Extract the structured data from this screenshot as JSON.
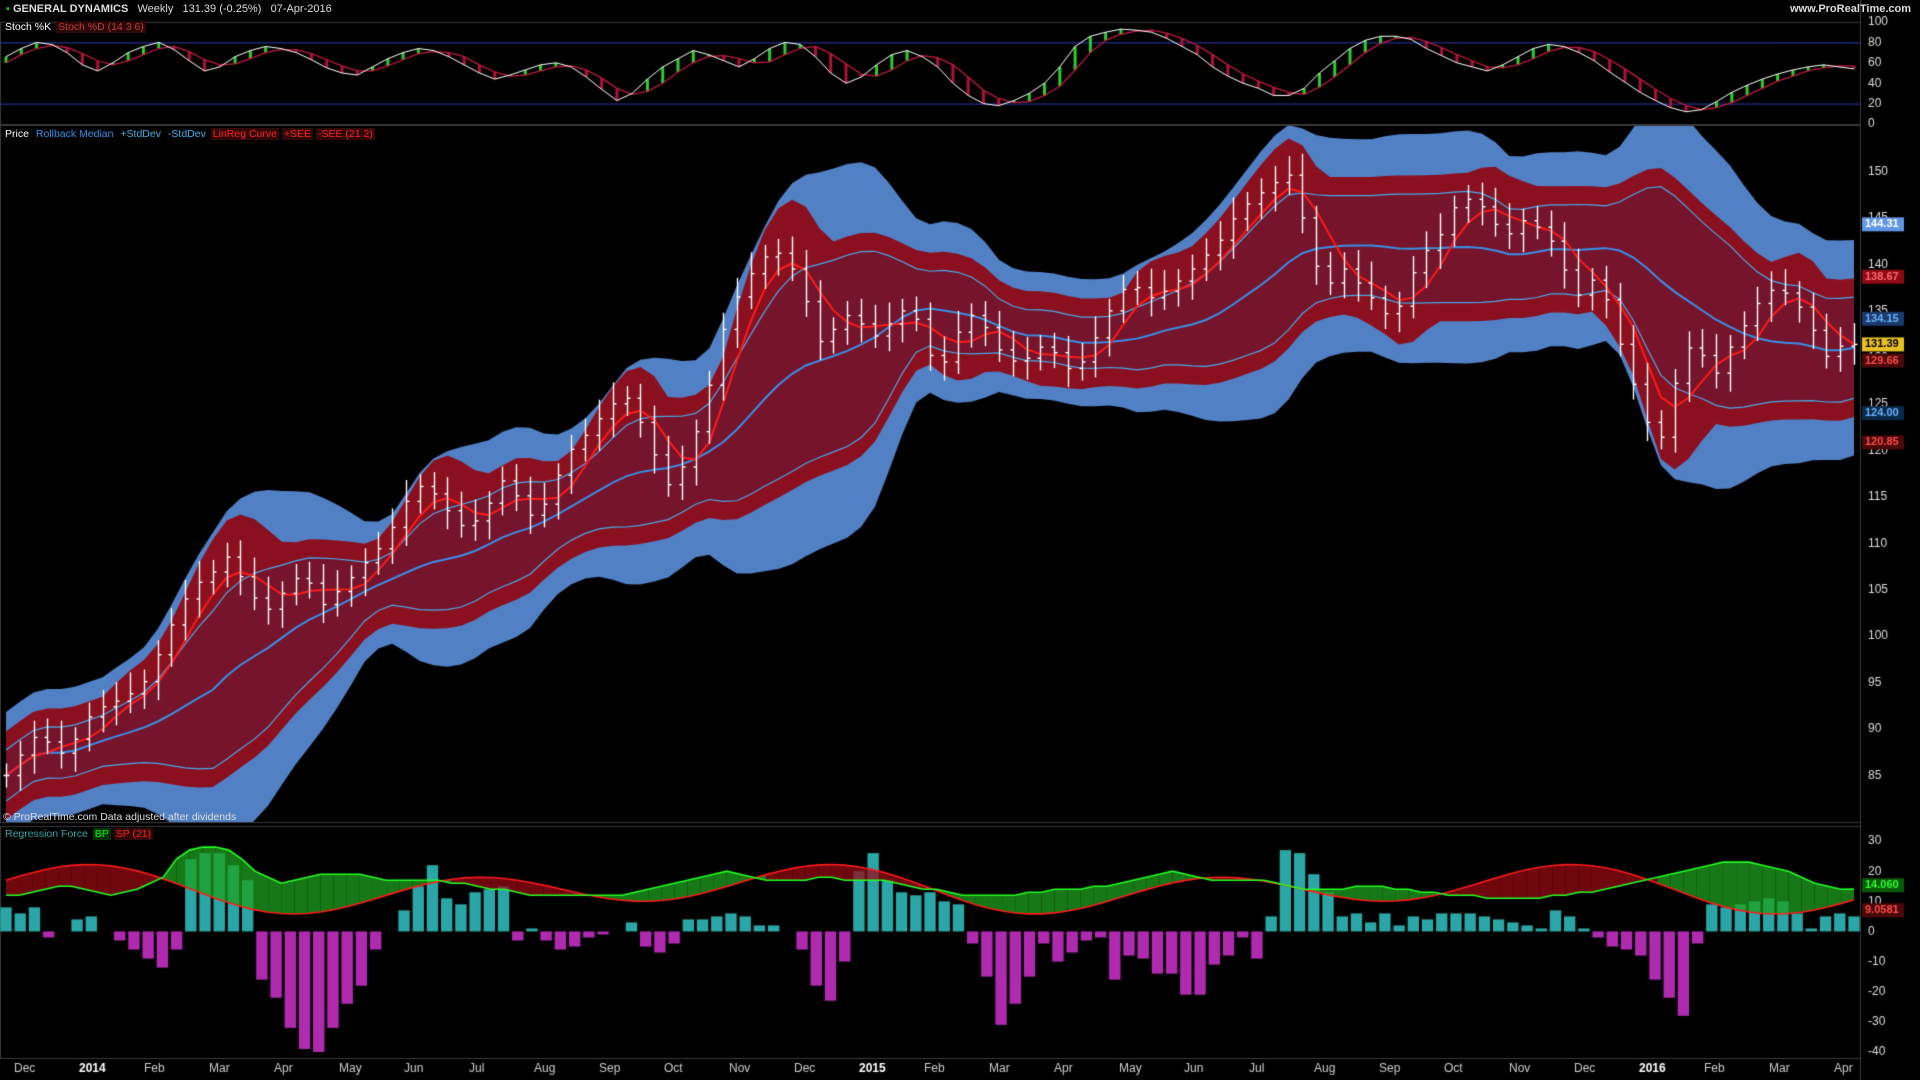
{
  "header": {
    "symbol": "GENERAL DYNAMICS",
    "period": "Weekly",
    "quote": "131.39 (-0.25%)",
    "date": "07-Apr-2016",
    "site": "www.ProRealTime.com"
  },
  "colors": {
    "bull_green": "#2ecc2e",
    "bear_red": "#b0103a",
    "band_red": "#8e0a16",
    "median_blue": "#3a8ee8",
    "cloud_blue": "#5f97e6",
    "linreg_red": "#ff1a1a",
    "hist_teal": "#2aa6a6",
    "hist_magenta": "#b02ab0"
  },
  "stoch_legend": [
    "Stoch %K",
    "Stoch %D (14 3 6)"
  ],
  "price_legend": [
    "Price",
    "Rollback Median",
    "+StdDev",
    "-StdDev",
    "LinReg Curve",
    "+SEE",
    "-SEE (21 2)"
  ],
  "force_legend": [
    "Regression Force",
    "BP",
    "SP (21)"
  ],
  "footer_note": "© ProRealTime.com  Data adjusted after dividends",
  "chart_data": [
    {
      "type": "line",
      "panel": "stochastic",
      "ylim": [
        0,
        100
      ],
      "ticks": [
        "100",
        "80",
        "60",
        "40",
        "20",
        "0"
      ],
      "levels": [
        80,
        20
      ],
      "k": [
        66,
        74,
        80,
        78,
        70,
        58,
        52,
        60,
        70,
        76,
        80,
        73,
        62,
        52,
        56,
        66,
        72,
        76,
        74,
        70,
        63,
        55,
        50,
        48,
        56,
        64,
        70,
        74,
        72,
        66,
        58,
        50,
        44,
        48,
        53,
        58,
        60,
        56,
        46,
        34,
        23,
        30,
        44,
        56,
        64,
        72,
        68,
        62,
        56,
        64,
        74,
        80,
        78,
        66,
        50,
        40,
        46,
        58,
        68,
        72,
        66,
        56,
        40,
        28,
        20,
        18,
        23,
        30,
        40,
        56,
        76,
        86,
        90,
        93,
        92,
        90,
        84,
        76,
        68,
        56,
        47,
        40,
        35,
        28,
        28,
        35,
        50,
        62,
        74,
        82,
        86,
        86,
        83,
        74,
        67,
        60,
        56,
        52,
        58,
        66,
        74,
        78,
        76,
        70,
        62,
        51,
        41,
        31,
        23,
        16,
        12,
        14,
        22,
        31,
        38,
        44,
        49,
        53,
        56,
        58,
        56,
        54
      ],
      "d": [
        60,
        68,
        74,
        77,
        75,
        69,
        62,
        58,
        62,
        68,
        74,
        76,
        71,
        63,
        58,
        59,
        64,
        70,
        73,
        73,
        69,
        63,
        57,
        52,
        52,
        57,
        63,
        69,
        71,
        70,
        66,
        58,
        51,
        47,
        48,
        52,
        56,
        57,
        53,
        45,
        35,
        29,
        32,
        40,
        51,
        60,
        66,
        67,
        64,
        60,
        61,
        68,
        74,
        76,
        69,
        59,
        49,
        47,
        53,
        62,
        67,
        65,
        58,
        46,
        33,
        25,
        21,
        22,
        28,
        37,
        53,
        70,
        82,
        88,
        91,
        92,
        89,
        84,
        77,
        68,
        58,
        49,
        42,
        36,
        31,
        29,
        36,
        46,
        58,
        70,
        79,
        84,
        85,
        81,
        75,
        68,
        62,
        56,
        55,
        58,
        64,
        71,
        75,
        75,
        71,
        63,
        54,
        44,
        34,
        25,
        18,
        14,
        16,
        21,
        28,
        35,
        42,
        47,
        52,
        55,
        57,
        57
      ]
    },
    {
      "type": "ohlc",
      "panel": "price",
      "ylim": [
        80,
        155
      ],
      "y_ticks": [
        85,
        90,
        95,
        100,
        105,
        110,
        115,
        120,
        125,
        130,
        135,
        140,
        145,
        150
      ],
      "last_value_labels": {
        "+SEE upper": "144.31",
        "+StdDev": "138.67",
        "Rollback Median": "134.15",
        "Price": "131.39",
        "LinReg Curve": "129.66",
        "-StdDev": "124.00",
        "-SEE lower": "120.85"
      },
      "close": [
        85.0,
        87.2,
        89.1,
        88.6,
        87.4,
        88.9,
        91.3,
        92.4,
        93.0,
        93.8,
        95.1,
        98.0,
        101.2,
        104.0,
        105.8,
        106.9,
        108.5,
        106.4,
        104.1,
        102.9,
        104.6,
        106.2,
        105.7,
        103.4,
        104.8,
        106.3,
        107.9,
        109.4,
        111.7,
        114.5,
        116.1,
        115.3,
        113.5,
        111.9,
        112.4,
        114.3,
        116.7,
        115.1,
        113.0,
        114.2,
        117.3,
        120.1,
        121.6,
        123.4,
        125.0,
        125.6,
        123.0,
        119.5,
        116.3,
        118.2,
        122.0,
        127.0,
        133.0,
        136.5,
        139.0,
        140.8,
        141.2,
        139.5,
        136.0,
        131.7,
        133.0,
        134.5,
        133.6,
        132.3,
        133.6,
        135.0,
        134.1,
        130.2,
        129.5,
        132.7,
        134.5,
        133.2,
        130.8,
        129.6,
        129.9,
        131.1,
        130.5,
        128.8,
        129.5,
        132.1,
        135.0,
        137.3,
        137.5,
        136.4,
        137.1,
        138.2,
        139.5,
        141.0,
        142.6,
        144.9,
        146.5,
        147.7,
        148.8,
        149.6,
        145.0,
        139.8,
        138.0,
        139.5,
        138.0,
        136.4,
        134.7,
        135.5,
        139.1,
        141.5,
        143.2,
        146.1,
        147.0,
        146.2,
        144.3,
        143.3,
        144.7,
        144.0,
        142.5,
        139.4,
        136.7,
        138.3,
        136.2,
        131.4,
        127.1,
        123.0,
        121.4,
        127.2,
        131.0,
        130.2,
        128.3,
        131.1,
        133.4,
        135.8,
        137.2,
        136.9,
        135.4,
        132.9,
        130.1,
        131.2,
        131.39
      ],
      "series_names": [
        "Price",
        "Rollback Median",
        "+StdDev",
        "-StdDev",
        "LinReg Curve",
        "+SEE",
        "-SEE (21 2)"
      ]
    },
    {
      "type": "bar",
      "panel": "regression_force",
      "ylim": [
        -42,
        35
      ],
      "y_ticks": [
        30,
        20,
        10,
        0,
        -10,
        -20,
        -30,
        -40
      ],
      "last_value_labels": {
        "BP": "14.060",
        "SP": "9.0581"
      },
      "values": [
        8,
        6,
        8,
        -2,
        0,
        4,
        5,
        0,
        -3,
        -6,
        -9,
        -12,
        -6,
        24,
        26,
        26,
        22,
        17,
        -16,
        -22,
        -32,
        -39,
        -40,
        -32,
        -24,
        -18,
        -6,
        0,
        7,
        15,
        22,
        11,
        9,
        13,
        14,
        15,
        -3,
        1,
        -3,
        -6,
        -5,
        -2,
        -1,
        0,
        3,
        -5,
        -7,
        -4,
        4,
        4,
        5,
        6,
        5,
        2,
        2,
        0,
        -6,
        -18,
        -23,
        -10,
        20,
        26,
        17,
        13,
        12,
        13,
        10,
        9,
        -4,
        -15,
        -31,
        -24,
        -15,
        -4,
        -10,
        -7,
        -3,
        -2,
        -16,
        -8,
        -9,
        -14,
        -14,
        -21,
        -21,
        -11,
        -8,
        -2,
        -9,
        5,
        27,
        26,
        19,
        13,
        5,
        6,
        3,
        6,
        2,
        5,
        4,
        6,
        6,
        6,
        5,
        4,
        3,
        2,
        1,
        7,
        5,
        1,
        -2,
        -5,
        -6,
        -8,
        -16,
        -22,
        -28,
        -4,
        9,
        8,
        9,
        10,
        11,
        10,
        6,
        1,
        5,
        6,
        5
      ],
      "bp": [
        12,
        12,
        13,
        14,
        15,
        15,
        14,
        13,
        12,
        13,
        14,
        16,
        18,
        24,
        27,
        28,
        28,
        27,
        24,
        20,
        18,
        16,
        17,
        18,
        19,
        19,
        19,
        19,
        18,
        17,
        17,
        17,
        17,
        17,
        16,
        16,
        15,
        14,
        14,
        13,
        12,
        12,
        12,
        12,
        12,
        12,
        12,
        12,
        13,
        14,
        15,
        16,
        17,
        18,
        19,
        20,
        19,
        18,
        17,
        17,
        17,
        17,
        18,
        18,
        17,
        17,
        17,
        17,
        16,
        15,
        14,
        14,
        13,
        12,
        12,
        12,
        12,
        12,
        13,
        13,
        14,
        14,
        14,
        15,
        15,
        16,
        17,
        18,
        19,
        20,
        19,
        18,
        17,
        17,
        17,
        17,
        17,
        16,
        15,
        14,
        14,
        14,
        14,
        15,
        15,
        15,
        14,
        14,
        13,
        13,
        12,
        12,
        12,
        11,
        11,
        11,
        11,
        11,
        12,
        12,
        13,
        13,
        14,
        15,
        16,
        17,
        18,
        19,
        20,
        21,
        22,
        23,
        23,
        23,
        22,
        21,
        20,
        18,
        16,
        15,
        14,
        14.06
      ]
    }
  ],
  "x_axis_labels": [
    "Dec",
    "2014",
    "Feb",
    "Mar",
    "Apr",
    "May",
    "Jun",
    "Jul",
    "Aug",
    "Sep",
    "Oct",
    "Nov",
    "Dec",
    "2015",
    "Feb",
    "Mar",
    "Apr",
    "May",
    "Jun",
    "Jul",
    "Aug",
    "Sep",
    "Oct",
    "Nov",
    "Dec",
    "2016",
    "Feb",
    "Mar",
    "Apr"
  ]
}
